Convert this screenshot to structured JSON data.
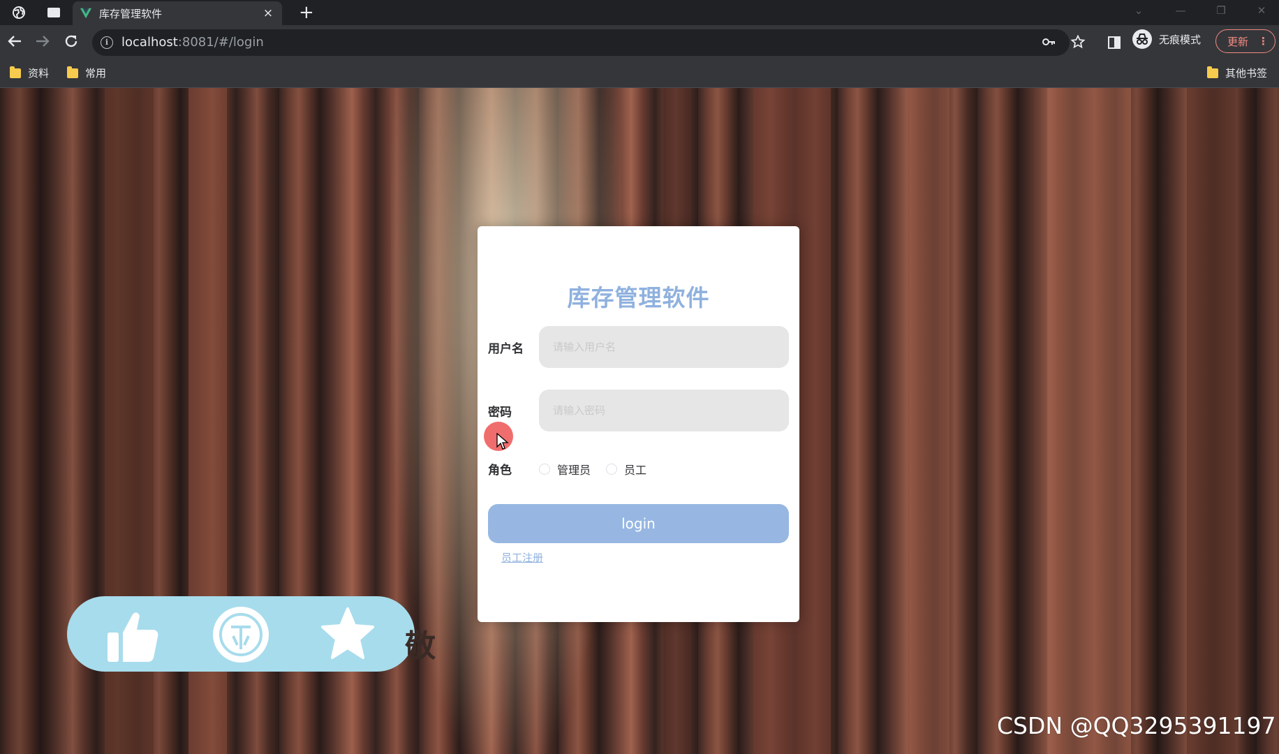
{
  "browser": {
    "tab": {
      "title": "库存管理软件",
      "close": "×"
    },
    "new_tab": "+",
    "address": {
      "host": "localhost",
      "rest": ":8081/#/login"
    },
    "incognito_label": "无痕模式",
    "update_label": "更新",
    "update_menu": "⋮",
    "bookmarks": [
      "资料",
      "常用"
    ],
    "other_bookmarks": "其他书签"
  },
  "login": {
    "title": "库存管理软件",
    "username_label": "用户名",
    "username_placeholder": "请输入用户名",
    "password_label": "密码",
    "password_placeholder": "请输入密码",
    "role_label": "角色",
    "roles": [
      "管理员",
      "员工"
    ],
    "login_button": "login",
    "register_link": "员工注册"
  },
  "overlay": {
    "icons": [
      "thumbs-up-icon",
      "coin-icon",
      "star-icon"
    ],
    "partial_text": "敬",
    "accent": "#a7dcec"
  },
  "watermark": "CSDN @QQ3295391197",
  "colors": {
    "title_blue": "#8fb1de",
    "button_blue": "#97b7e2",
    "chrome_dark": "#202124",
    "chrome_toolbar": "#35363a",
    "update_red": "#f28b82"
  }
}
